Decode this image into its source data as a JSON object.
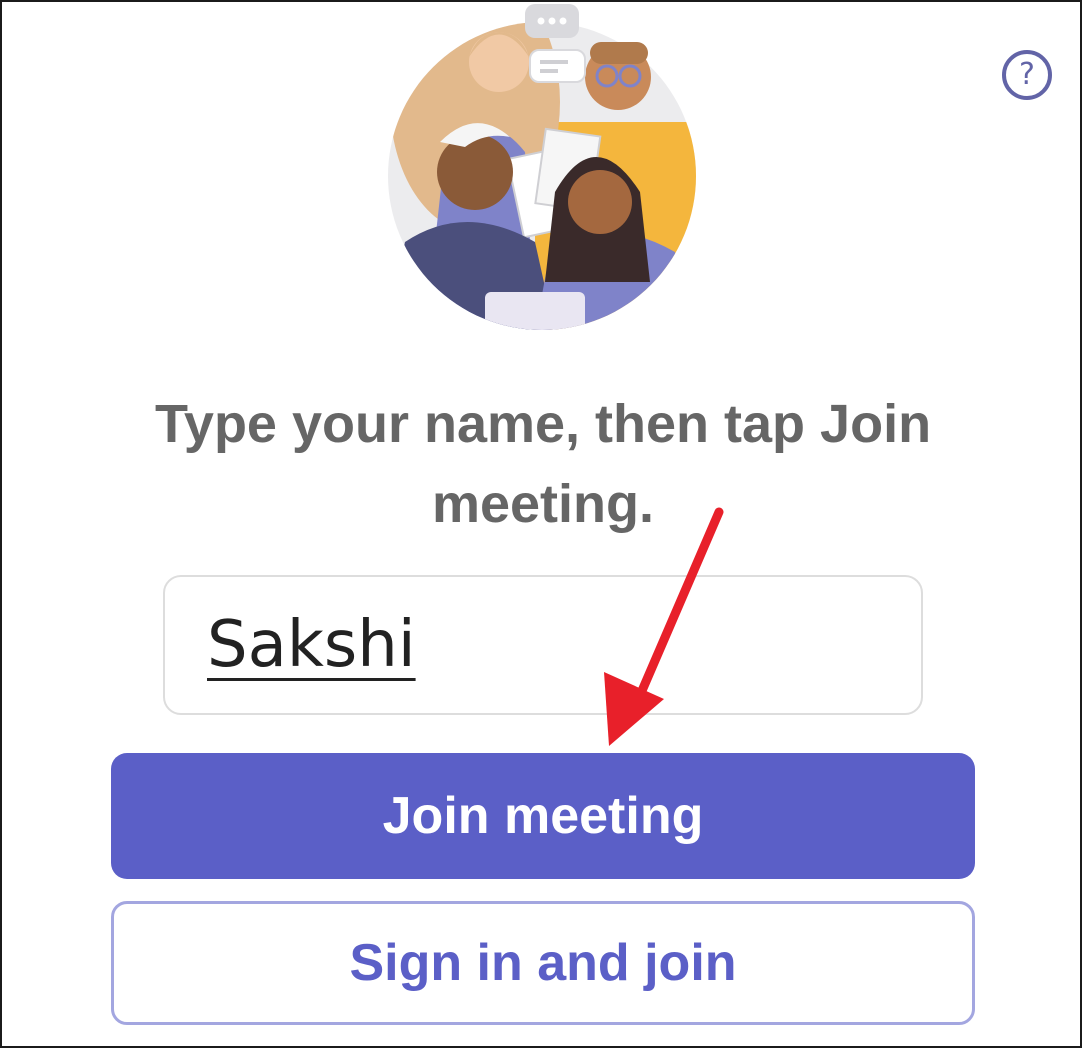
{
  "help": {
    "icon": "question-circle-icon",
    "label": "?"
  },
  "illustration": {
    "icon": "people-meeting-illustration",
    "colors": {
      "circle_bg": "#e8e8ea",
      "purple": "#7f83c9",
      "yellow": "#f4b63d",
      "skin_dark": "#8a5a38",
      "skin_light": "#f1c9a5"
    }
  },
  "prompt": {
    "line1": "Type your name, then tap Join",
    "line2": "meeting."
  },
  "name_field": {
    "value": "Sakshi"
  },
  "buttons": {
    "join_label": "Join meeting",
    "signin_label": "Sign in and join"
  },
  "annotation": {
    "icon": "red-arrow-icon",
    "color": "#e8202a"
  },
  "colors": {
    "accent": "#5b5fc7",
    "accent_border": "#a3a6e0",
    "text_gray": "#666666"
  }
}
